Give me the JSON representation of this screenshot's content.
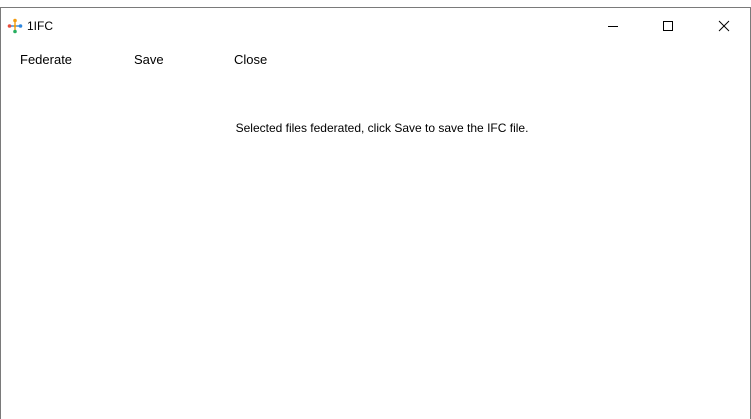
{
  "window": {
    "title": "1IFC",
    "icon": "federate-nodes-icon",
    "controls": {
      "minimize": "minimize-icon",
      "maximize": "maximize-icon",
      "close": "close-icon"
    }
  },
  "menu": {
    "items": [
      {
        "label": "Federate"
      },
      {
        "label": "Save"
      },
      {
        "label": "Close"
      }
    ]
  },
  "main": {
    "status": "Selected files federated, click Save to save the IFC file."
  },
  "colors": {
    "icon_orange": "#f39c12",
    "icon_blue": "#2e86de",
    "icon_red": "#e74c3c",
    "icon_green": "#27ae60"
  }
}
